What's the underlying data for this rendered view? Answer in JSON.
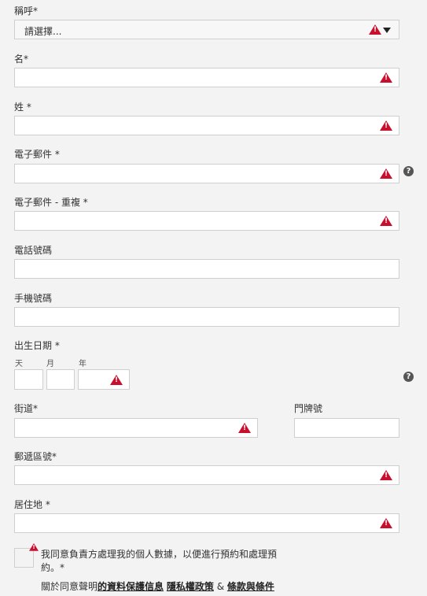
{
  "form": {
    "salutation": {
      "label": "稱呼*",
      "placeholder": "請選擇..."
    },
    "first_name": {
      "label": "名*"
    },
    "last_name": {
      "label": "姓 *"
    },
    "email": {
      "label": "電子郵件 *"
    },
    "email_repeat": {
      "label": "電子郵件 - 重複 *"
    },
    "phone": {
      "label": "電話號碼"
    },
    "mobile": {
      "label": "手機號碼"
    },
    "dob": {
      "label": "出生日期 *",
      "day_label": "天",
      "month_label": "月",
      "year_label": "年"
    },
    "street": {
      "label": "街道*"
    },
    "house_number": {
      "label": "門牌號"
    },
    "postal_code": {
      "label": "郵遞區號*"
    },
    "city": {
      "label": "居住地 *"
    },
    "consent": {
      "text": "我同意負責方處理我的個人數據，以便進行預約和處理預約。*",
      "links_prefix": "關於同意聲明",
      "link_privacy_info": "的資料保護信息",
      "link_privacy_policy": "隱私權政策",
      "amp": "&",
      "link_terms": "條款與條件"
    }
  },
  "help_icon": "?",
  "colors": {
    "warning": "#c8102e",
    "background": "#f3f3f3"
  }
}
